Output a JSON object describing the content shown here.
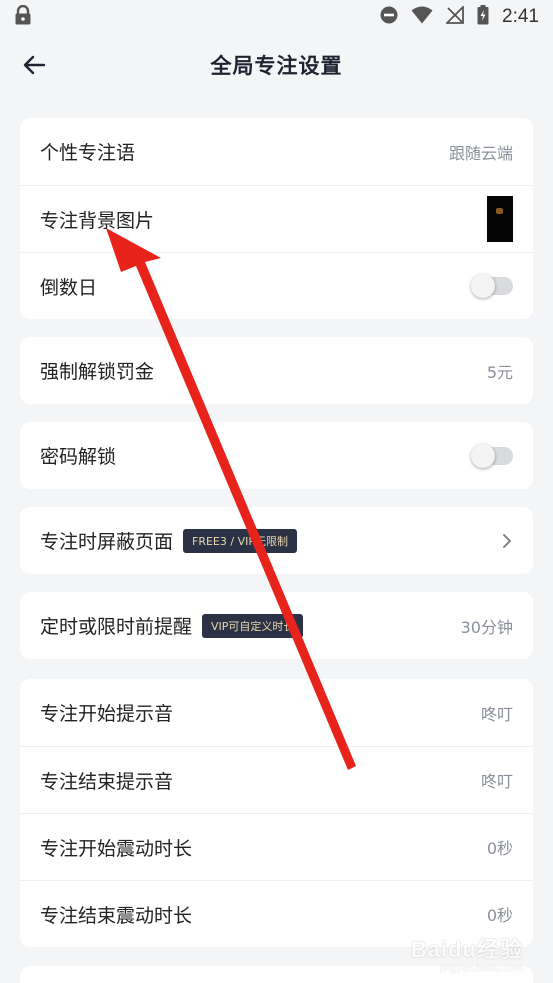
{
  "status_bar": {
    "time": "2:41",
    "icons": [
      "lock-icon",
      "do-not-disturb-icon",
      "wifi-icon",
      "no-signal-icon",
      "battery-charging-icon"
    ]
  },
  "header": {
    "title": "全局专注设置",
    "back_icon": "arrow-left-icon"
  },
  "groups": {
    "g1": {
      "slogan": {
        "label": "个性专注语",
        "value": "跟随云端"
      },
      "background": {
        "label": "专注背景图片"
      },
      "countdown": {
        "label": "倒数日",
        "toggle_on": false
      }
    },
    "g2": {
      "penalty": {
        "label": "强制解锁罚金",
        "value": "5元"
      }
    },
    "g3": {
      "password": {
        "label": "密码解锁",
        "toggle_on": false
      }
    },
    "g4": {
      "block": {
        "label": "专注时屏蔽页面",
        "badge": "FREE3 / VIP无限制"
      }
    },
    "g5": {
      "reminder": {
        "label": "定时或限时前提醒",
        "badge": "VIP可自定义时长",
        "value": "30分钟"
      }
    },
    "g6": {
      "start_sound": {
        "label": "专注开始提示音",
        "value": "咚叮"
      },
      "end_sound": {
        "label": "专注结束提示音",
        "value": "咚叮"
      },
      "start_vibrate": {
        "label": "专注开始震动时长",
        "value": "0秒"
      },
      "end_vibrate": {
        "label": "专注结束震动时长",
        "value": "0秒"
      }
    }
  },
  "colors": {
    "annotation_arrow": "#e8231c",
    "badge_bg": "#2b3245",
    "badge_text": "#e8d7b0"
  },
  "watermark": {
    "main": "Baidu经验",
    "sub": "jingyan.baidu.com"
  }
}
